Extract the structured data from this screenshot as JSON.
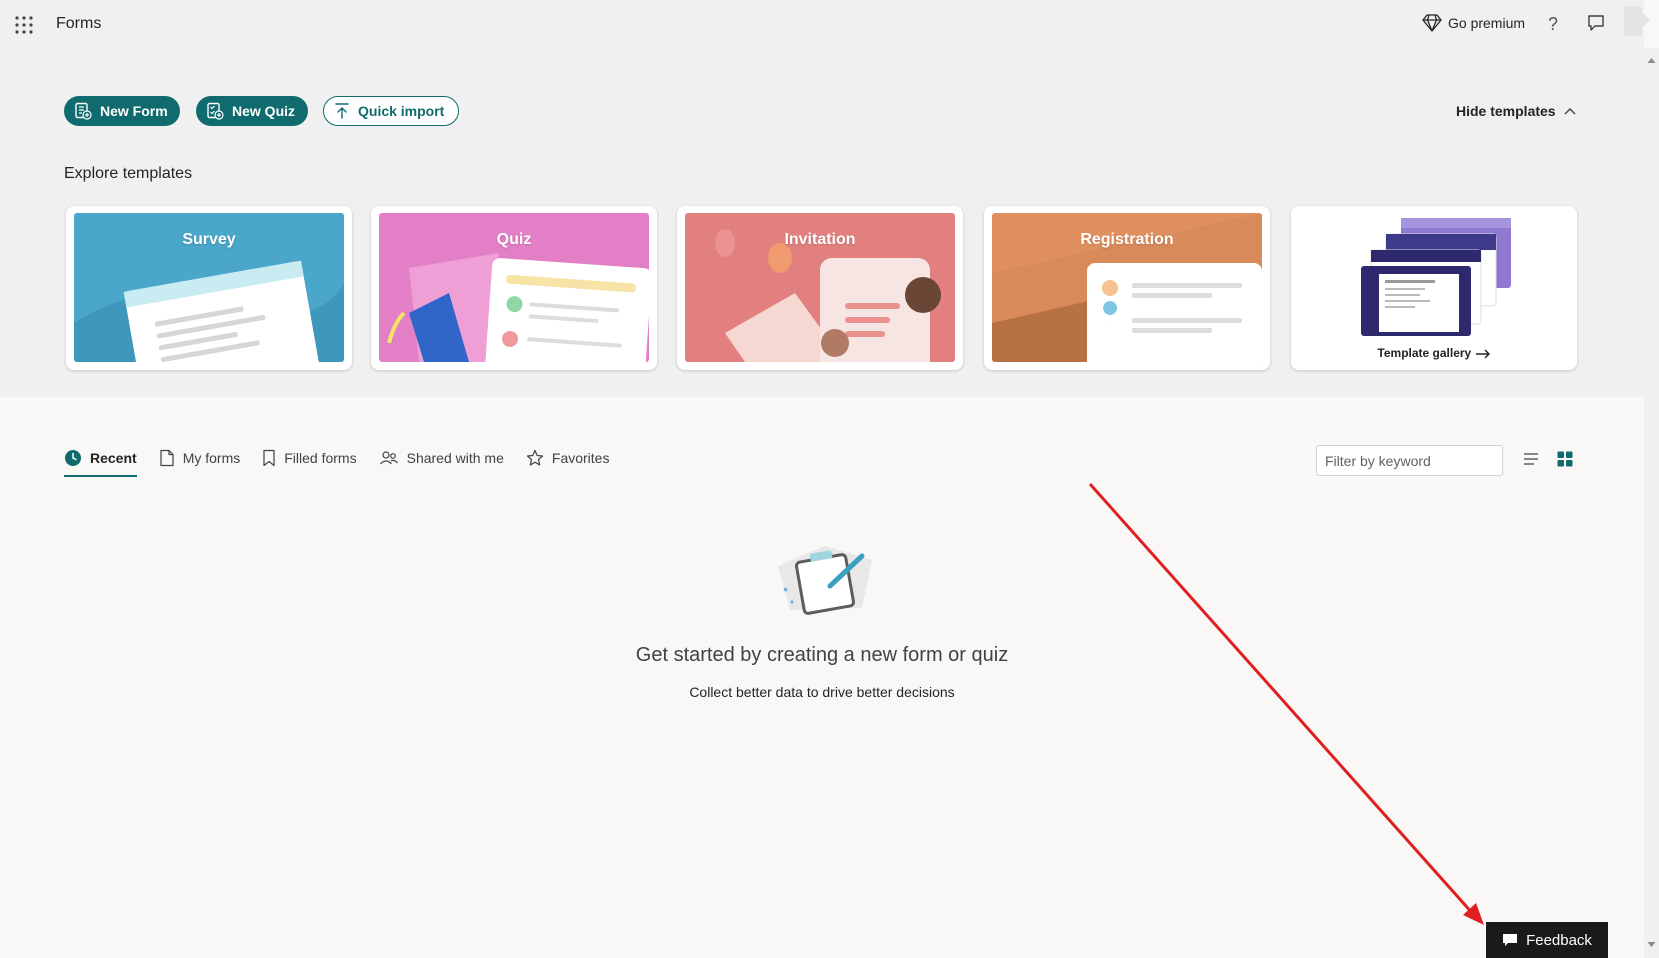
{
  "header": {
    "app_title": "Forms",
    "premium_label": "Go premium",
    "help_glyph": "?"
  },
  "actions": {
    "new_form": "New Form",
    "new_quiz": "New Quiz",
    "quick_import": "Quick import",
    "hide_templates": "Hide templates"
  },
  "templates": {
    "heading": "Explore templates",
    "cards": [
      {
        "label": "Survey",
        "color": "#4aa7c9"
      },
      {
        "label": "Quiz",
        "color": "#e07ec4"
      },
      {
        "label": "Invitation",
        "color": "#e07f7f"
      },
      {
        "label": "Registration",
        "color": "#e09060"
      }
    ],
    "gallery_label": "Template gallery"
  },
  "tabs": [
    {
      "label": "Recent",
      "icon": "clock-icon"
    },
    {
      "label": "My forms",
      "icon": "document-icon"
    },
    {
      "label": "Filled forms",
      "icon": "bookmark-icon"
    },
    {
      "label": "Shared with me",
      "icon": "people-icon"
    },
    {
      "label": "Favorites",
      "icon": "star-icon"
    }
  ],
  "filter": {
    "placeholder": "Filter by keyword"
  },
  "empty_state": {
    "title": "Get started by creating a new form or quiz",
    "subtitle": "Collect better data to drive better decisions"
  },
  "feedback": {
    "label": "Feedback"
  },
  "colors": {
    "accent": "#0f6b6e",
    "annotation_arrow": "#e02020"
  }
}
